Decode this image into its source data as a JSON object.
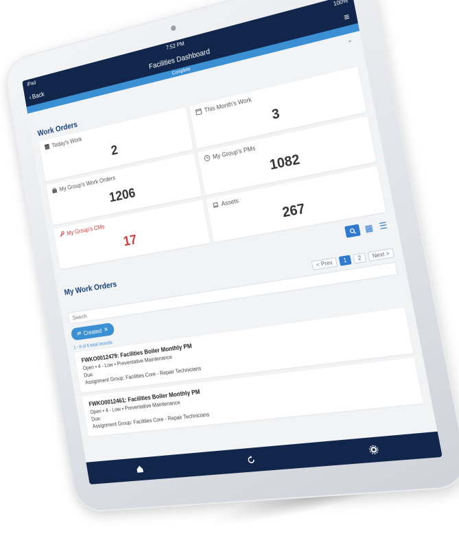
{
  "status": {
    "carrier": "iPad",
    "time": "7:52 PM",
    "battery": "100%"
  },
  "nav": {
    "title": "Facilities Dashboard",
    "back_label": "Back"
  },
  "env_label": "Complete",
  "dashboard": {
    "section_title": "Work Orders",
    "tiles": [
      {
        "label": "Today's Work",
        "value": "2",
        "icon": "calendar-icon"
      },
      {
        "label": "This Month's Work",
        "value": "3",
        "icon": "calendar-month-icon"
      },
      {
        "label": "My Group's Work Orders",
        "value": "1206",
        "icon": "briefcase-icon"
      },
      {
        "label": "My Group's PMs",
        "value": "1082",
        "icon": "clock-icon"
      },
      {
        "label": "My Group's CMs",
        "value": "17",
        "icon": "wrench-icon",
        "alert": true
      },
      {
        "label": "Assets",
        "value": "267",
        "icon": "laptop-icon"
      }
    ]
  },
  "my_work_orders": {
    "title": "My Work Orders",
    "pager": {
      "prev": "< Prev",
      "pages": [
        "1",
        "2"
      ],
      "next": "Next >"
    },
    "search_placeholder": "Search",
    "filter_chip": "Created",
    "count_text": "1 - 6 of 6 total records",
    "items": [
      {
        "title": "FWKO0012479: Facilities Boiler Monthly PM",
        "status": "Open • 4 - Low • Preventative Maintenance",
        "due": "Due:",
        "group": "Assignment Group: Facilities Core - Repair Technicians"
      },
      {
        "title": "FWKO0012461: Facilities Boiler Monthly PM",
        "status": "Open • 4 - Low • Preventative Maintenance",
        "due": "Due:",
        "group": "Assignment Group: Facilities Core - Repair Technicians"
      }
    ]
  },
  "colors": {
    "navy": "#11264a",
    "accent": "#3b8fd3",
    "alert": "#d33a3a"
  }
}
